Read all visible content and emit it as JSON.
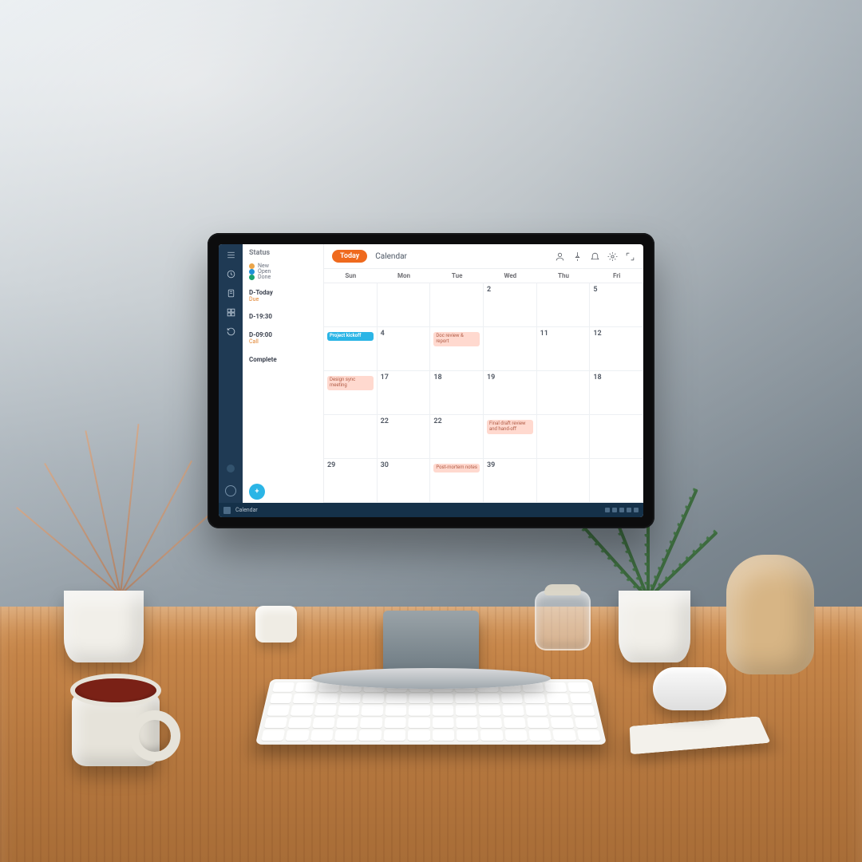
{
  "toolbar": {
    "primary_button": "Today",
    "title": "Calendar"
  },
  "toolbar_icons": [
    "user-icon",
    "pin-icon",
    "bell-icon",
    "settings-icon",
    "expand-icon"
  ],
  "sidebar_icons": [
    "menu-icon",
    "clock-icon",
    "note-icon",
    "grid-icon",
    "history-icon"
  ],
  "panel": {
    "heading": "Status",
    "filters": [
      {
        "label": "New",
        "color": "#eba54a"
      },
      {
        "label": "Open",
        "color": "#1e90d6"
      },
      {
        "label": "Done",
        "color": "#1aa36f"
      }
    ],
    "items": [
      {
        "title": "D-Today",
        "sub": "Due"
      },
      {
        "title": "D-19:30",
        "sub": ""
      },
      {
        "title": "D-09:00",
        "sub": "Call"
      },
      {
        "title": "Complete",
        "sub": ""
      }
    ],
    "add_label": "+"
  },
  "day_headers": [
    "Sun",
    "Mon",
    "Tue",
    "Wed",
    "Thu",
    "Fri"
  ],
  "weeks": [
    [
      {
        "n": ""
      },
      {
        "n": ""
      },
      {
        "n": ""
      },
      {
        "n": "2"
      },
      {
        "n": ""
      },
      {
        "n": "5"
      }
    ],
    [
      {
        "n": "",
        "ev": {
          "cls": "ev-blue",
          "text": "Project kickoff"
        }
      },
      {
        "n": "4"
      },
      {
        "n": "",
        "ev": {
          "cls": "ev-pink",
          "text": "Doc review & report"
        }
      },
      {
        "n": ""
      },
      {
        "n": "11"
      },
      {
        "n": "12"
      }
    ],
    [
      {
        "n": "",
        "ev": {
          "cls": "ev-pink",
          "text": "Design sync meeting"
        }
      },
      {
        "n": "17"
      },
      {
        "n": "18"
      },
      {
        "n": "19"
      },
      {
        "n": ""
      },
      {
        "n": "18"
      }
    ],
    [
      {
        "n": ""
      },
      {
        "n": "22"
      },
      {
        "n": "22"
      },
      {
        "n": "",
        "ev": {
          "cls": "ev-pink",
          "text": "Final draft review and hand-off"
        }
      },
      {
        "n": ""
      },
      {
        "n": ""
      }
    ],
    [
      {
        "n": "29"
      },
      {
        "n": "30"
      },
      {
        "n": "",
        "ev": {
          "cls": "ev-pink",
          "text": "Post-mortem notes"
        }
      },
      {
        "n": "39"
      },
      {
        "n": ""
      },
      {
        "n": ""
      }
    ]
  ],
  "taskbar": {
    "label": "Calendar"
  }
}
